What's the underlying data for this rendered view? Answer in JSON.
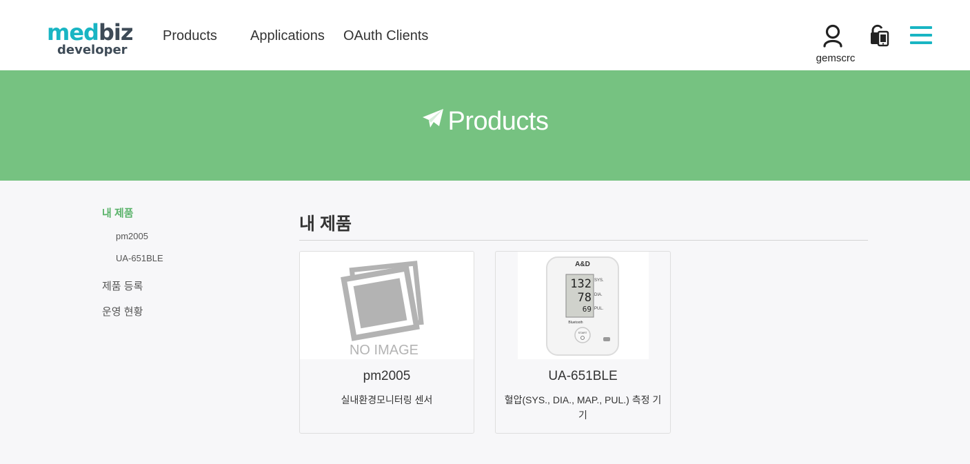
{
  "logo": {
    "part1": "med",
    "part2": "biz",
    "sub": "developer"
  },
  "nav": {
    "products": "Products",
    "applications": "Applications",
    "oauth_clients": "OAuth Clients"
  },
  "user": {
    "name": "gemscrc"
  },
  "icons": {
    "user": "user-icon",
    "lock": "unlock-phone-icon",
    "menu": "hamburger-menu-icon",
    "banner": "paper-plane-icon"
  },
  "colors": {
    "brand_teal": "#19b5c3",
    "banner_green": "#76c281",
    "sidebar_active": "#5bb36b"
  },
  "banner": {
    "title": "Products"
  },
  "sidebar": {
    "my_products": "내 제품",
    "sub_items": [
      "pm2005",
      "UA-651BLE"
    ],
    "register": "제품 등록",
    "operations": "운영 현황"
  },
  "main": {
    "title": "내 제품",
    "products": [
      {
        "name": "pm2005",
        "desc": "실내환경모니터링 센서",
        "image_text": "NO IMAGE"
      },
      {
        "name": "UA-651BLE",
        "desc": "혈압(SYS., DIA., MAP., PUL.) 측정 기기",
        "device": {
          "brand": "A&D",
          "sys": "132",
          "dia": "78",
          "pul": "69",
          "sys_label": "SYS.",
          "dia_label": "DIA.",
          "pul_label": "PUL.",
          "start_label": "START",
          "bt_label": "Bluetooth"
        }
      }
    ]
  }
}
